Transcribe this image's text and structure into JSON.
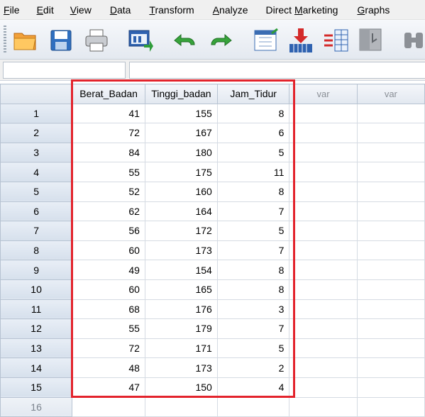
{
  "menu": {
    "items": [
      {
        "pre": "",
        "ul": "F",
        "post": "ile"
      },
      {
        "pre": "",
        "ul": "E",
        "post": "dit"
      },
      {
        "pre": "",
        "ul": "V",
        "post": "iew"
      },
      {
        "pre": "",
        "ul": "D",
        "post": "ata"
      },
      {
        "pre": "",
        "ul": "T",
        "post": "ransform"
      },
      {
        "pre": "",
        "ul": "A",
        "post": "nalyze"
      },
      {
        "pre": "Direct ",
        "ul": "M",
        "post": "arketing"
      },
      {
        "pre": "",
        "ul": "G",
        "post": "raphs"
      }
    ]
  },
  "toolbar": {
    "buttons": [
      "open-folder-icon",
      "save-icon",
      "print-icon",
      "recall-dialog-icon",
      "undo-icon",
      "redo-icon",
      "goto-case-icon",
      "goto-variable-icon",
      "variables-icon",
      "run-descriptives-icon",
      "find-icon"
    ]
  },
  "editor": {
    "cell_name": "",
    "cell_value": ""
  },
  "grid": {
    "columns": [
      "Berat_Badan",
      "Tinggi_badan",
      "Jam_Tidur",
      "var",
      "var"
    ],
    "rows": [
      {
        "num": "1",
        "values": [
          "41",
          "155",
          "8"
        ]
      },
      {
        "num": "2",
        "values": [
          "72",
          "167",
          "6"
        ]
      },
      {
        "num": "3",
        "values": [
          "84",
          "180",
          "5"
        ]
      },
      {
        "num": "4",
        "values": [
          "55",
          "175",
          "11"
        ]
      },
      {
        "num": "5",
        "values": [
          "52",
          "160",
          "8"
        ]
      },
      {
        "num": "6",
        "values": [
          "62",
          "164",
          "7"
        ]
      },
      {
        "num": "7",
        "values": [
          "56",
          "172",
          "5"
        ]
      },
      {
        "num": "8",
        "values": [
          "60",
          "173",
          "7"
        ]
      },
      {
        "num": "9",
        "values": [
          "49",
          "154",
          "8"
        ]
      },
      {
        "num": "10",
        "values": [
          "60",
          "165",
          "8"
        ]
      },
      {
        "num": "11",
        "values": [
          "68",
          "176",
          "3"
        ]
      },
      {
        "num": "12",
        "values": [
          "55",
          "179",
          "7"
        ]
      },
      {
        "num": "13",
        "values": [
          "72",
          "171",
          "5"
        ]
      },
      {
        "num": "14",
        "values": [
          "48",
          "173",
          "2"
        ]
      },
      {
        "num": "15",
        "values": [
          "47",
          "150",
          "4"
        ]
      },
      {
        "num": "16",
        "values": [
          "",
          "",
          ""
        ]
      }
    ]
  },
  "colors": {
    "highlight": "#e3232c"
  }
}
